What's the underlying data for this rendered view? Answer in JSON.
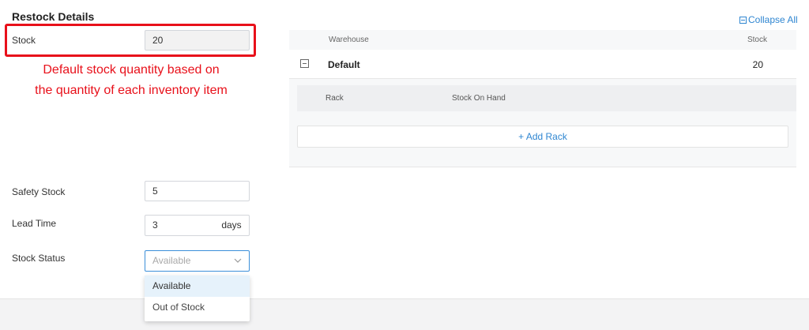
{
  "section": {
    "title": "Restock Details"
  },
  "stock": {
    "label": "Stock",
    "value": "20"
  },
  "annotation": {
    "line1": "Default stock quantity based on",
    "line2": "the quantity of each inventory item"
  },
  "safety_stock": {
    "label": "Safety Stock",
    "value": "5"
  },
  "lead_time": {
    "label": "Lead Time",
    "value": "3",
    "unit": "days"
  },
  "stock_status": {
    "label": "Stock Status",
    "placeholder": "Available",
    "options": [
      "Available",
      "Out of Stock"
    ],
    "highlighted_option": "Available"
  },
  "warehouse": {
    "collapse_all_label": "Collapse All",
    "col_warehouse": "Warehouse",
    "col_stock": "Stock",
    "rows": [
      {
        "name": "Default",
        "stock": "20"
      }
    ],
    "rack_col_rack": "Rack",
    "rack_col_stock_on_hand": "Stock On Hand",
    "add_rack_label": "+ Add Rack"
  },
  "colors": {
    "accent": "#2f86d1",
    "annotation": "#e8101a",
    "focus_border": "#3b8fd9"
  }
}
